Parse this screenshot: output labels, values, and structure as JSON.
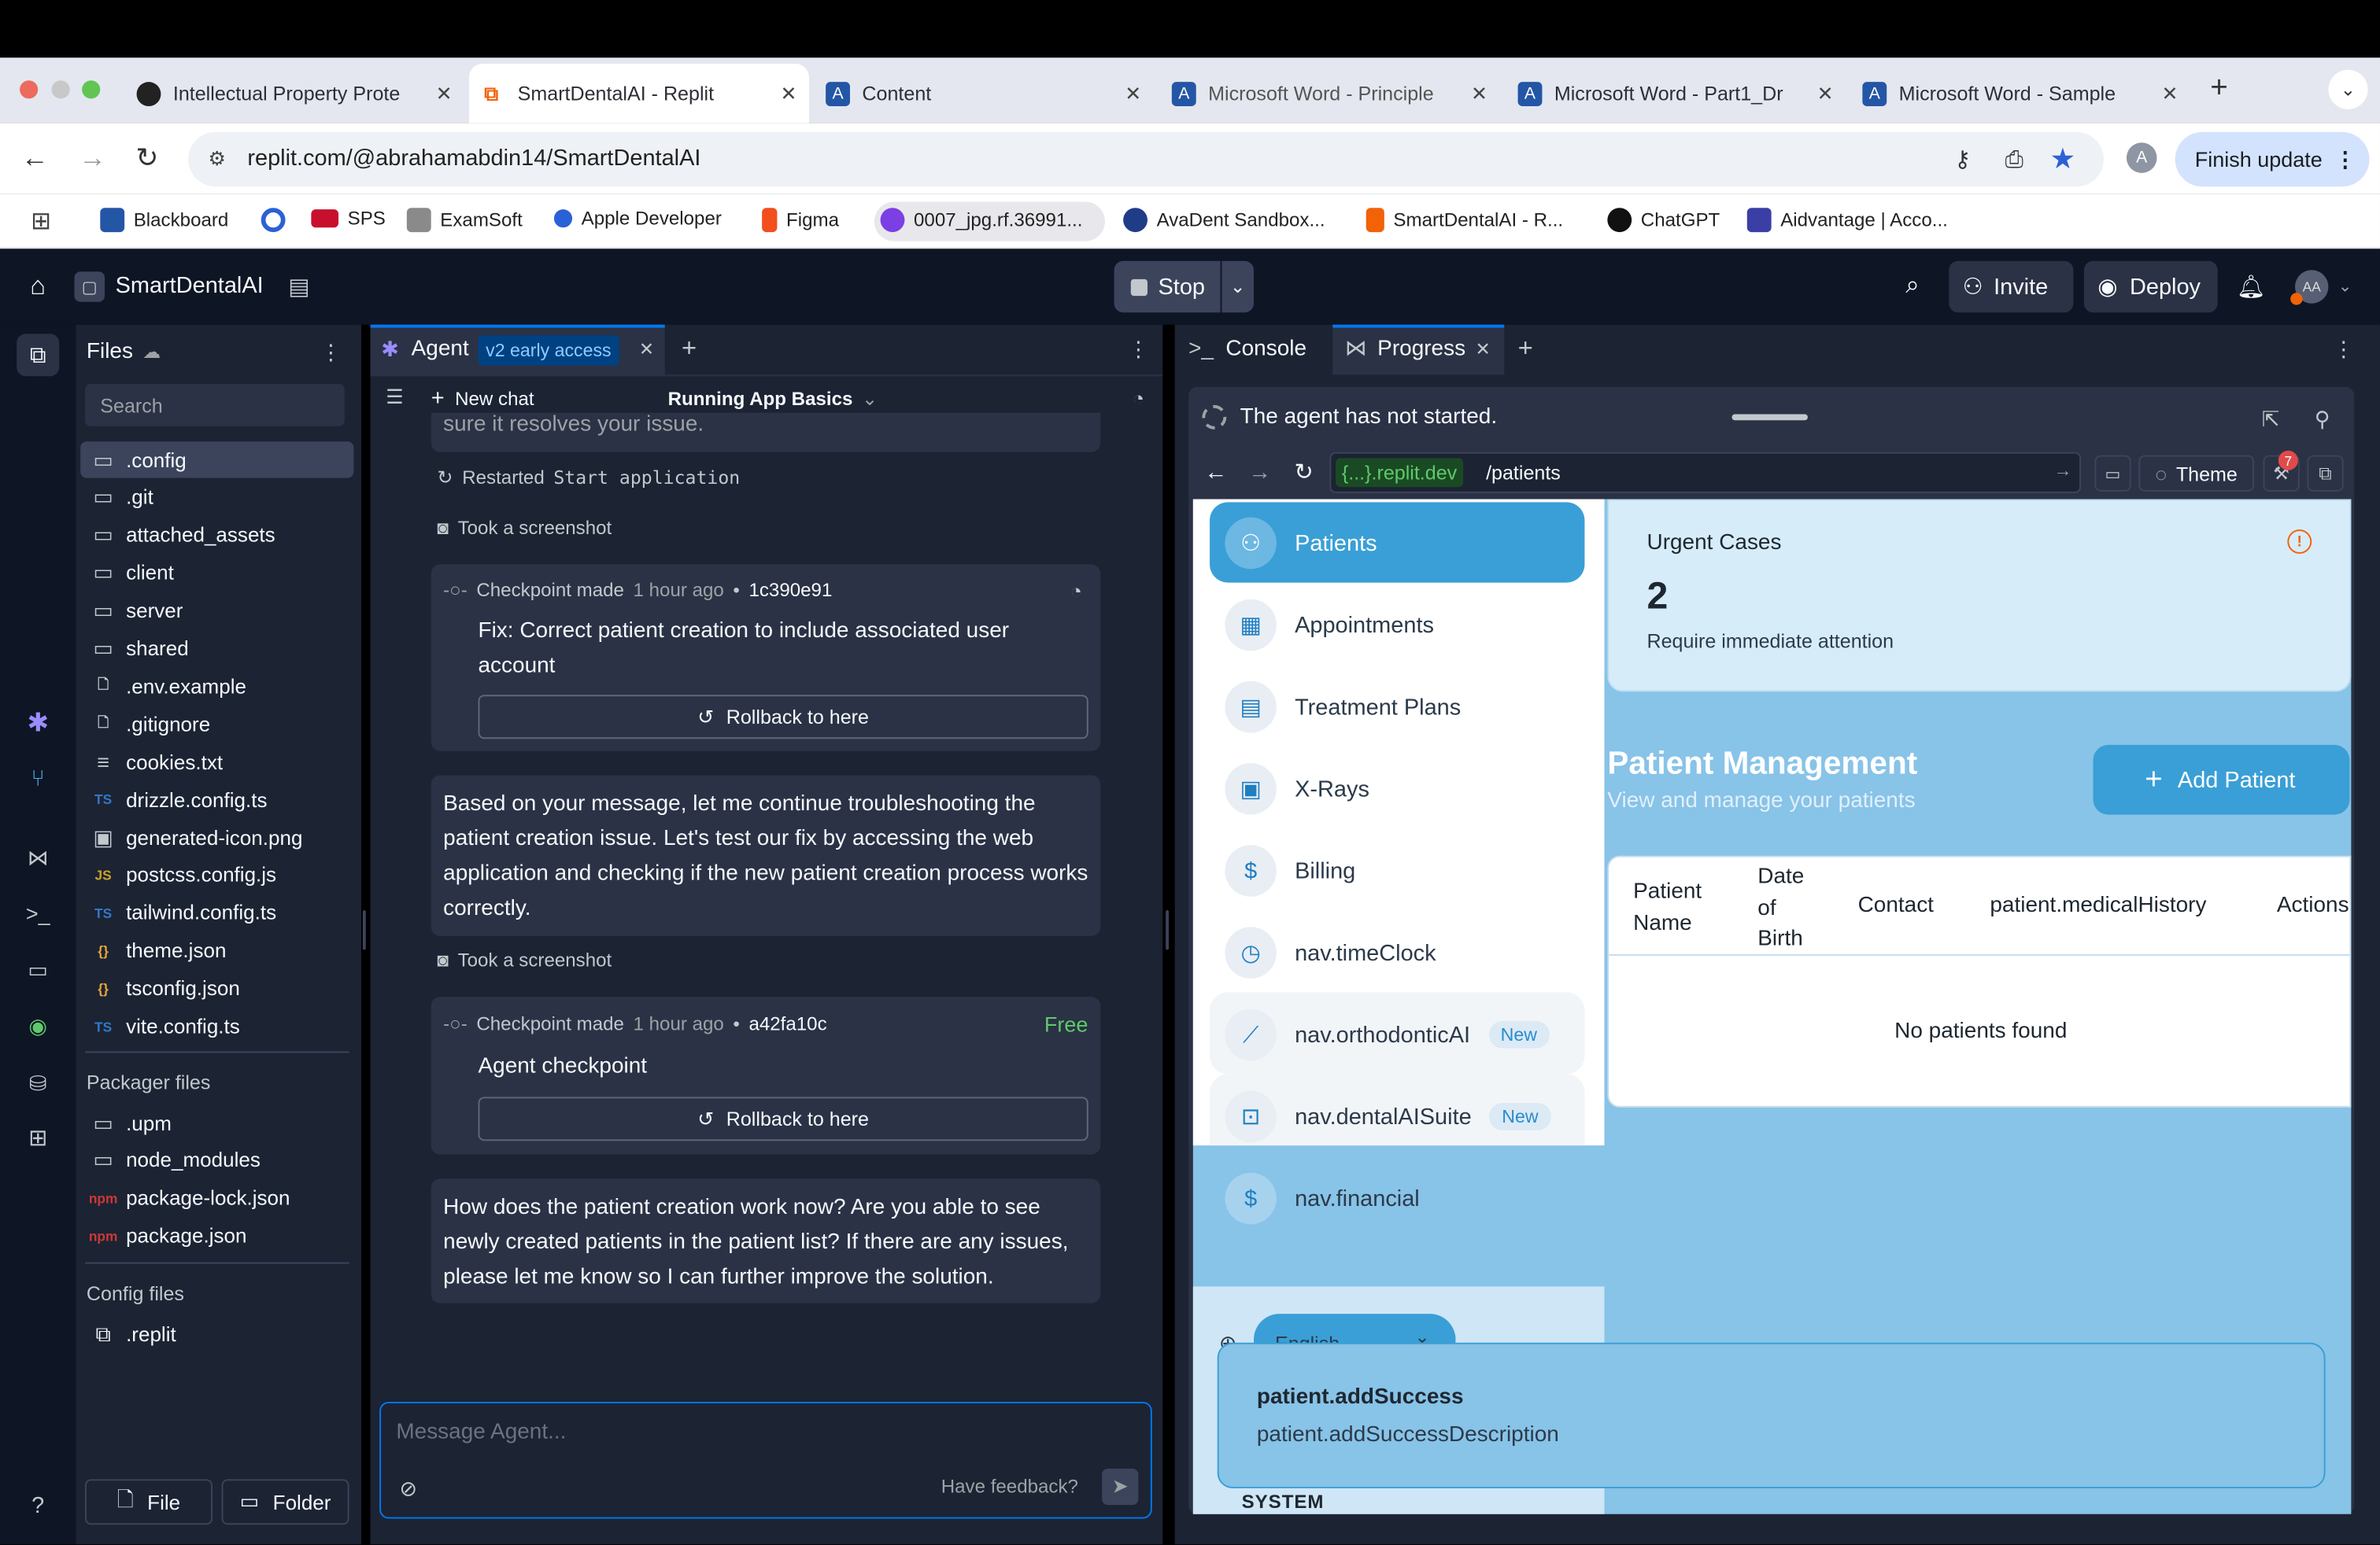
{
  "browser": {
    "tabs": [
      {
        "title": "Intellectual Property Prote",
        "icon": "github-icon"
      },
      {
        "title": "SmartDentalAI - Replit",
        "icon": "replit-icon"
      },
      {
        "title": "Content",
        "icon": "anthology-icon"
      },
      {
        "title": "Microsoft Word - Principle",
        "icon": "anthology-icon"
      },
      {
        "title": "Microsoft Word - Part1_Dr",
        "icon": "anthology-icon"
      },
      {
        "title": "Microsoft Word - Sample",
        "icon": "anthology-icon"
      }
    ],
    "url": "replit.com/@abrahamabdin14/SmartDentalAI",
    "profile_initial": "A",
    "finish_update": "Finish update",
    "bookmarks": [
      "Blackboard",
      "SPS",
      "ExamSoft",
      "Apple Developer",
      "Figma",
      "0007_jpg.rf.36991...",
      "AvaDent Sandbox...",
      "SmartDentalAI - R...",
      "ChatGPT",
      "Aidvantage | Acco..."
    ]
  },
  "replit": {
    "project_name": "SmartDentalAI",
    "stop": "Stop",
    "invite": "Invite",
    "deploy": "Deploy",
    "avatar_initials": "AA"
  },
  "files": {
    "title": "Files",
    "search_placeholder": "Search",
    "items": [
      ".config",
      ".git",
      "attached_assets",
      "client",
      "server",
      "shared",
      ".env.example",
      ".gitignore",
      "cookies.txt",
      "drizzle.config.ts",
      "generated-icon.png",
      "postcss.config.js",
      "tailwind.config.ts",
      "theme.json",
      "tsconfig.json",
      "vite.config.ts"
    ],
    "packager_title": "Packager files",
    "packager_items": [
      ".upm",
      "node_modules",
      "package-lock.json",
      "package.json"
    ],
    "config_title": "Config files",
    "config_items": [
      ".replit"
    ],
    "file_btn": "File",
    "folder_btn": "Folder"
  },
  "agent": {
    "tab_label": "Agent",
    "badge": "v2 early access",
    "new_chat": "New chat",
    "thread_title": "Running App Basics",
    "cut_text": "sure it resolves your issue.",
    "restarted": "Restarted",
    "restarted_code": "Start application",
    "screenshot1": "Took a screenshot",
    "checkpoint1": {
      "label": "Checkpoint made",
      "time": "1 hour ago",
      "sep": "•",
      "hash": "1c390e91",
      "desc": "Fix: Correct patient creation to include associated user account",
      "rollback": "Rollback to here"
    },
    "message1": "Based on your message, let me continue troubleshooting the patient creation issue. Let's test our fix by accessing the web application and checking if the new patient creation process works correctly.",
    "screenshot2": "Took a screenshot",
    "checkpoint2": {
      "label": "Checkpoint made",
      "time": "1 hour ago",
      "sep": "•",
      "hash": "a42fa10c",
      "free": "Free",
      "desc": "Agent checkpoint",
      "rollback": "Rollback to here"
    },
    "message2": "How does the patient creation work now? Are you able to see newly created patients in the patient list? If there are any issues, please let me know so I can further improve the solution.",
    "input_placeholder": "Message Agent...",
    "feedback": "Have feedback?"
  },
  "right": {
    "console_tab": "Console",
    "progress_tab": "Progress",
    "agent_status": "The agent has not started.",
    "domain": "{...}.replit.dev",
    "path": "/patients",
    "theme": "Theme",
    "badge_count": "7"
  },
  "app": {
    "nav": [
      {
        "label": "Patients",
        "icon": "users-icon"
      },
      {
        "label": "Appointments",
        "icon": "calendar-icon"
      },
      {
        "label": "Treatment Plans",
        "icon": "document-icon"
      },
      {
        "label": "X-Rays",
        "icon": "image-icon"
      },
      {
        "label": "Billing",
        "icon": "dollar-icon"
      },
      {
        "label": "nav.timeClock",
        "icon": "clock-icon"
      },
      {
        "label": "nav.orthodonticAI",
        "icon": "ruler-icon",
        "badge": "New"
      },
      {
        "label": "nav.dentalAISuite",
        "icon": "bot-icon",
        "badge": "New"
      },
      {
        "label": "nav.financial",
        "icon": "dollar-icon"
      }
    ],
    "urgent": {
      "title": "Urgent Cases",
      "count": "2",
      "sub": "Require immediate attention"
    },
    "heading": "Patient Management",
    "subheading": "View and manage your patients",
    "add_patient": "Add Patient",
    "table_headers": [
      "Patient Name",
      "Date of Birth",
      "Contact",
      "patient.medicalHistory",
      "Actions"
    ],
    "empty": "No patients found",
    "language": "English",
    "toast": {
      "title": "patient.addSuccess",
      "desc": "patient.addSuccessDescription"
    },
    "system_label": "SYSTEM"
  }
}
